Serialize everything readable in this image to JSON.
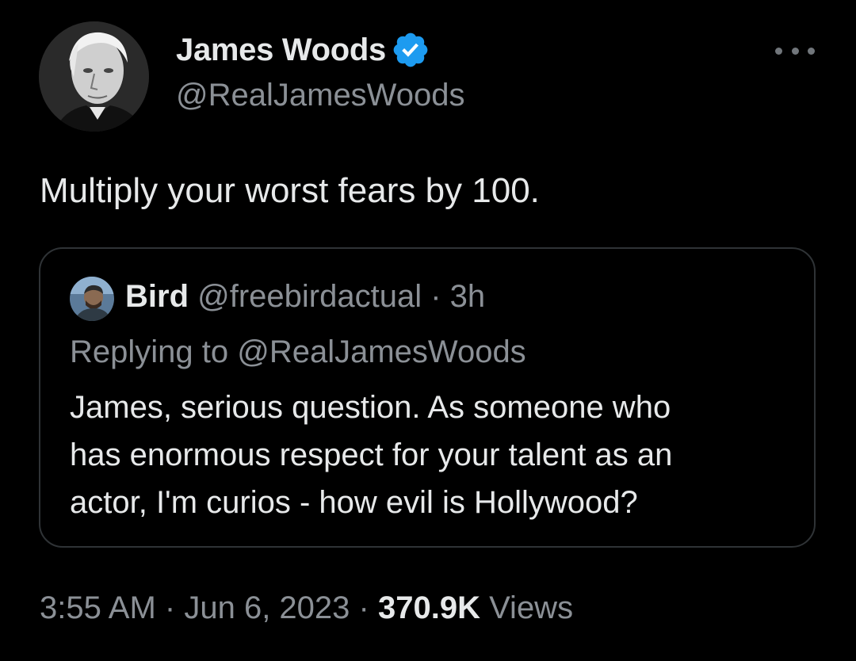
{
  "tweet": {
    "author_name": "James Woods",
    "author_handle": "@RealJamesWoods",
    "text": "Multiply your worst fears by 100.",
    "time": "3:55 AM",
    "date": "Jun 6, 2023",
    "separator": "·",
    "views_count": "370.9K",
    "views_label": "Views"
  },
  "quoted": {
    "author_name": "Bird",
    "author_handle": "@freebirdactual",
    "separator": "·",
    "age": "3h",
    "replying_to": "Replying to @RealJamesWoods",
    "text_lines": [
      "James, serious question. As someone who",
      "has enormous respect for your talent as an",
      "actor, I'm curios - how evil is Hollywood?"
    ]
  },
  "icons": {
    "verified": "verified-badge-icon",
    "more": "more-options-icon"
  },
  "colors": {
    "background": "#000000",
    "primary_text": "#e7e9ea",
    "secondary_text": "#8b9096",
    "border": "#2f3336",
    "verified_blue": "#1d9bf0"
  }
}
